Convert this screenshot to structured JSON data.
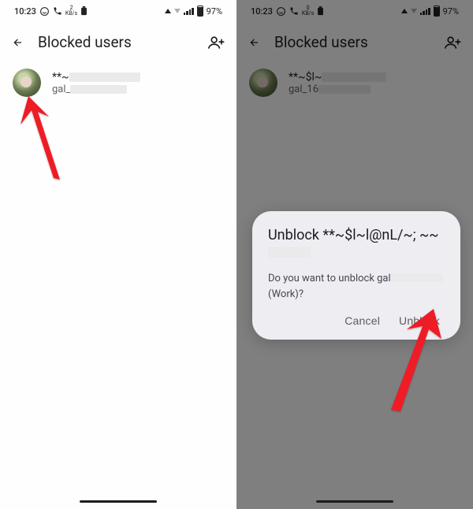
{
  "status": {
    "time": "10:23",
    "kbs_num": "2",
    "kbs_label": "KB/s",
    "battery": "97%"
  },
  "header": {
    "title": "Blocked users"
  },
  "user": {
    "name_visible": "**~",
    "sub_visible": "gal_"
  },
  "user_right": {
    "name_visible": "**~$l~",
    "sub_visible": "gal_16"
  },
  "dialog": {
    "title_prefix": "Unblock **~$l~l@nL/~; ~~",
    "body_prefix": "Do you want to unblock gal",
    "body_suffix": "(Work)?",
    "cancel": "Cancel",
    "confirm": "Unblock"
  }
}
